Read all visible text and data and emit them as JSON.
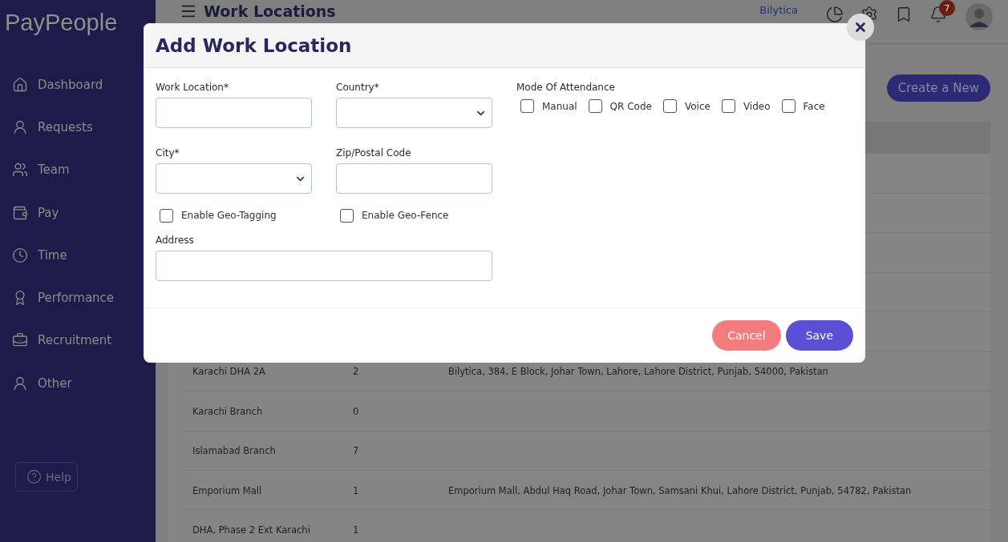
{
  "sidebar": {
    "logo": "PayPeople",
    "items": [
      {
        "label": "Dashboard",
        "kind": "home"
      },
      {
        "label": "Requests",
        "kind": "requests"
      },
      {
        "label": "Team",
        "kind": "team"
      },
      {
        "label": "Pay",
        "kind": "pay"
      },
      {
        "label": "Time",
        "kind": "time"
      },
      {
        "label": "Performance",
        "kind": "performance"
      },
      {
        "label": "Recruitment",
        "kind": "recruitment"
      },
      {
        "label": "Other",
        "kind": "other"
      }
    ],
    "help": "Help"
  },
  "header": {
    "title": "Work Locations",
    "company": "Bilytica",
    "notification_count": "7"
  },
  "create_button": "Create a New",
  "table": {
    "rows": [
      {
        "name": "Karachi DHA 2A",
        "count": "2",
        "address": "Bilytica, 384, E Block, Johar Town, Lahore, Lahore District, Punjab, 54000, Pakistan"
      },
      {
        "name": "Karachi Branch",
        "count": "0"
      },
      {
        "name": "Islamabad Branch",
        "count": "7"
      },
      {
        "name": "Emporium Mall",
        "count": "1",
        "address": "Emporium Mall, Abdul Haq Road, Johar Town, Samsani Khui, Lahore District, Punjab, 54782, Pakistan"
      },
      {
        "name": "DHA, Phase 2 Ext Karachi",
        "count": "1"
      }
    ]
  },
  "dialog": {
    "title": "Add Work Location",
    "fields": [
      {
        "label": "Work Location*",
        "kind": "text"
      },
      {
        "label": "Country*",
        "kind": "select"
      },
      {
        "label": "City*",
        "kind": "select"
      },
      {
        "label": "Zip/Postal Code",
        "kind": "text"
      }
    ],
    "options": [
      {
        "label": "Enable Geo-Tagging",
        "checked": false
      },
      {
        "label": "Enable Geo-Fence",
        "checked": false
      }
    ],
    "address": {
      "label": "Address"
    },
    "attendance": {
      "label": "Mode Of Attendance",
      "modes": [
        {
          "label": "Manual",
          "checked": false
        },
        {
          "label": "QR Code",
          "checked": false
        },
        {
          "label": "Voice",
          "checked": false
        },
        {
          "label": "Video",
          "checked": false
        },
        {
          "label": "Face",
          "checked": false
        }
      ]
    },
    "cancel": "Cancel",
    "save": "Save"
  }
}
